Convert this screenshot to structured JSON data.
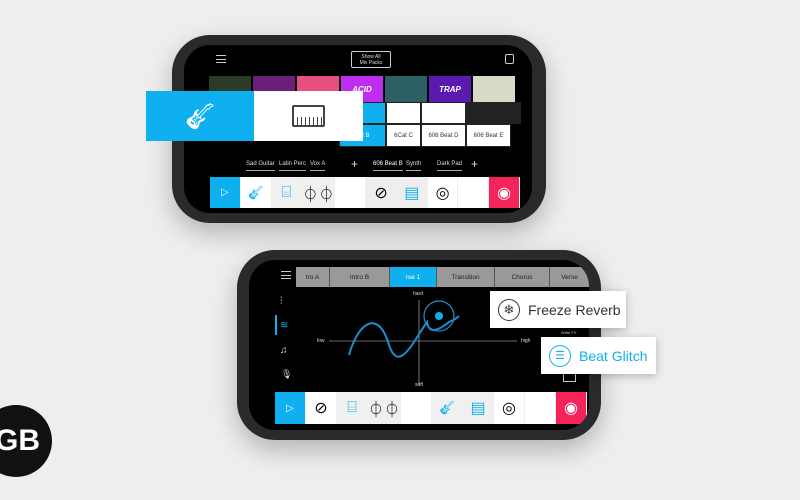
{
  "top_phone": {
    "header": {
      "mix_packs_button": "Show All\nMix Packs"
    },
    "grid_row2": [
      "eat B",
      "6Cat C",
      "606 Beat D",
      "606 Beat E"
    ],
    "tracks": [
      "Sad Guitar",
      "Latin Perc",
      "Vox A",
      "+",
      "606 Beat B",
      "Synth",
      "Dark Pad",
      "+"
    ],
    "album_art": [
      {
        "label": "",
        "color": "#2c3a2a"
      },
      {
        "label": "",
        "color": "#6b1f7a"
      },
      {
        "label": "",
        "color": "#e84e7e"
      },
      {
        "label": "ACID",
        "color": "#c02cf0"
      },
      {
        "label": "",
        "color": "#2d6064"
      },
      {
        "label": "TRAP",
        "color": "#5a1ab0"
      },
      {
        "label": "",
        "color": "#d8dac8"
      }
    ]
  },
  "bottom_phone": {
    "tabs": [
      "tro A",
      "Intro B",
      "rse 1",
      "Transition",
      "Chorus",
      "Verse"
    ],
    "active_tab": 2,
    "xy_pad": {
      "top": "hard",
      "bottom": "soft",
      "left": "low",
      "right": "high"
    },
    "write_fx": "Write FX",
    "fx_cards": [
      {
        "label": "Freeze Reverb",
        "icon": "snowflake-icon"
      },
      {
        "label": "Beat Glitch",
        "icon": "glitch-icon"
      }
    ]
  },
  "colors": {
    "accent": "#0eb0f0",
    "record": "#f4235a"
  },
  "logo": "iGB"
}
